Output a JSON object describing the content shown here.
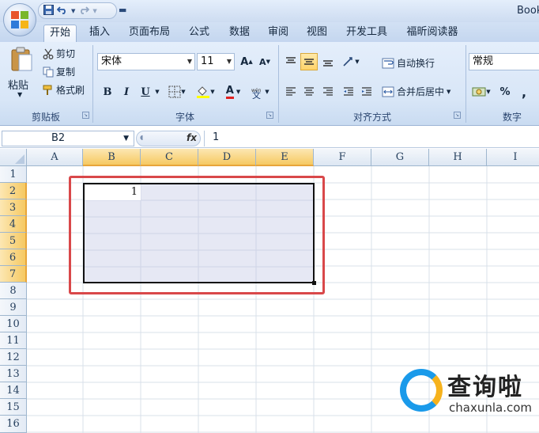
{
  "window": {
    "title": "Book"
  },
  "quick_access": {
    "save_icon": "save-icon",
    "undo_icon": "undo-icon",
    "redo_icon": "redo-icon"
  },
  "tabs": [
    {
      "label": "开始",
      "active": true
    },
    {
      "label": "插入"
    },
    {
      "label": "页面布局"
    },
    {
      "label": "公式"
    },
    {
      "label": "数据"
    },
    {
      "label": "审阅"
    },
    {
      "label": "视图"
    },
    {
      "label": "开发工具"
    },
    {
      "label": "福昕阅读器"
    }
  ],
  "ribbon": {
    "clipboard": {
      "paste": "粘贴",
      "cut": "剪切",
      "copy": "复制",
      "format_painter": "格式刷",
      "group": "剪贴板"
    },
    "font": {
      "name": "宋体",
      "size": "11",
      "bold": "B",
      "italic": "I",
      "underline": "U",
      "grow": "A",
      "shrink": "A",
      "font_color": "A",
      "phonetic": "wén",
      "group": "字体"
    },
    "alignment": {
      "wrap_text": "自动换行",
      "merge_center": "合并后居中",
      "group": "对齐方式"
    },
    "number": {
      "format": "常规",
      "percent": "%",
      "comma": ",",
      "group": "数字"
    }
  },
  "formula_bar": {
    "name_box": "B2",
    "fx": "fx",
    "content": "1"
  },
  "sheet": {
    "columns": [
      "A",
      "B",
      "C",
      "D",
      "E",
      "F",
      "G",
      "H",
      "I"
    ],
    "rows": [
      "1",
      "2",
      "3",
      "4",
      "5",
      "6",
      "7",
      "8",
      "9",
      "10",
      "11",
      "12",
      "13",
      "14",
      "15",
      "16"
    ],
    "selected_columns": [
      "B",
      "C",
      "D",
      "E"
    ],
    "selected_rows": [
      "2",
      "3",
      "4",
      "5",
      "6",
      "7"
    ],
    "active_cell": "B2",
    "cell_value": "1",
    "selection_range": "B2:E7"
  },
  "watermark": {
    "text": "查询啦",
    "url": "chaxunla.com"
  },
  "colors": {
    "highlight": "#d9484a",
    "selection_fill": "#e6e8f4",
    "header_selected": "#f6c962"
  }
}
